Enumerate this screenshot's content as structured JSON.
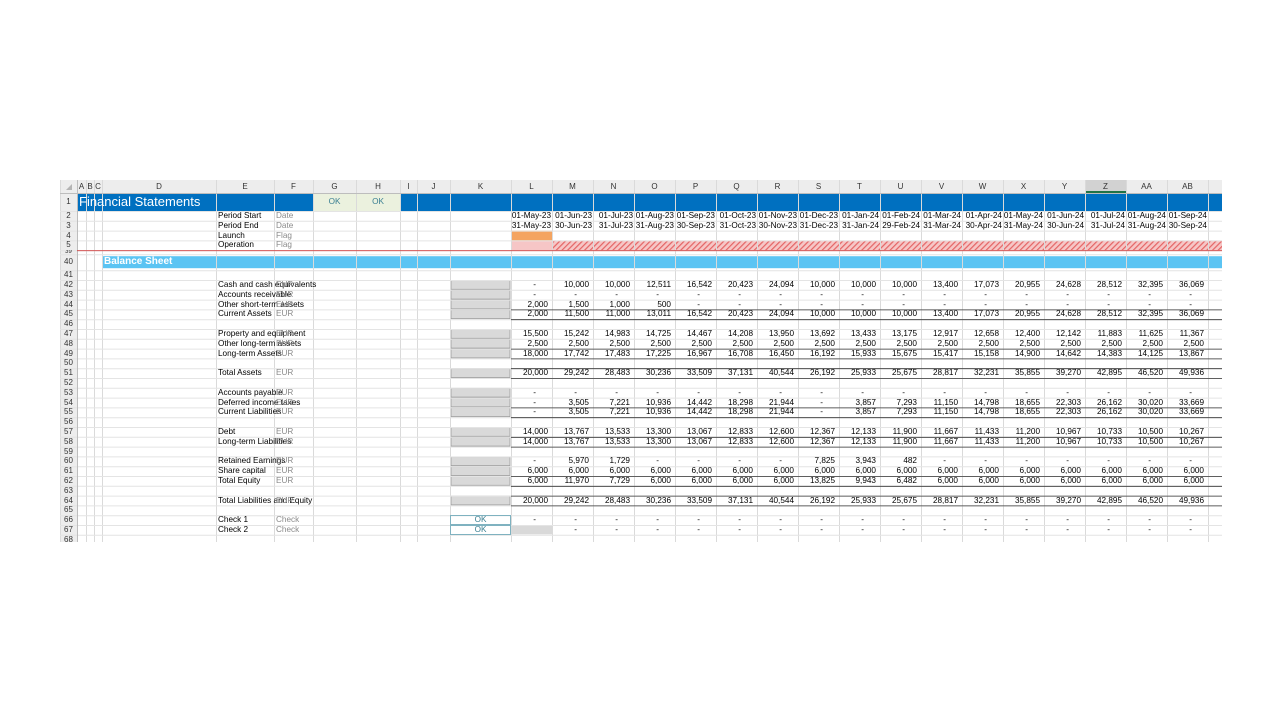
{
  "window": {
    "title": "Financial Statements"
  },
  "colors": {
    "title_band": "#0070C0",
    "section_band": "#5BC4F3",
    "ok_fill": "#EBF1DE",
    "launch_fill": "#F4A460",
    "operation_hatch": "#E46464",
    "input_grey": "#D9D9D9"
  },
  "columns": [
    "A",
    "B",
    "C",
    "D",
    "E",
    "F",
    "G",
    "H",
    "I",
    "J",
    "K",
    "L",
    "M",
    "N",
    "O",
    "P",
    "Q",
    "R",
    "S",
    "T",
    "U",
    "V",
    "W",
    "X",
    "Y",
    "Z",
    "AA",
    "AB"
  ],
  "selected_column": "Z",
  "header": {
    "title": "Financial Statements",
    "ok_cells": [
      "OK",
      "OK"
    ]
  },
  "timeline": [
    {
      "row": "2",
      "label": "Period Start",
      "unit": "Date",
      "values": [
        "01-May-23",
        "01-Jun-23",
        "01-Jul-23",
        "01-Aug-23",
        "01-Sep-23",
        "01-Oct-23",
        "01-Nov-23",
        "01-Dec-23",
        "01-Jan-24",
        "01-Feb-24",
        "01-Mar-24",
        "01-Apr-24",
        "01-May-24",
        "01-Jun-24",
        "01-Jul-24",
        "01-Aug-24",
        "01-Sep-24"
      ]
    },
    {
      "row": "3",
      "label": "Period End",
      "unit": "Date",
      "values": [
        "31-May-23",
        "30-Jun-23",
        "31-Jul-23",
        "31-Aug-23",
        "30-Sep-23",
        "31-Oct-23",
        "30-Nov-23",
        "31-Dec-23",
        "31-Jan-24",
        "29-Feb-24",
        "31-Mar-24",
        "30-Apr-24",
        "31-May-24",
        "30-Jun-24",
        "31-Jul-24",
        "31-Aug-24",
        "30-Sep-24"
      ]
    },
    {
      "row": "4",
      "label": "Launch",
      "unit": "Flag",
      "values": []
    },
    {
      "row": "5",
      "label": "Operation",
      "unit": "Flag",
      "values": []
    }
  ],
  "hidden_row_label": "39",
  "section": {
    "row": "40",
    "title": "Balance Sheet"
  },
  "rows": [
    {
      "row": "41",
      "label": "",
      "unit": "",
      "values": []
    },
    {
      "row": "42",
      "label": "Cash and cash equivalents",
      "unit": "EUR",
      "values": [
        "-",
        "10,000",
        "10,000",
        "12,511",
        "16,542",
        "20,423",
        "24,094",
        "10,000",
        "10,000",
        "10,000",
        "13,400",
        "17,073",
        "20,955",
        "24,628",
        "28,512",
        "32,395",
        "36,069"
      ]
    },
    {
      "row": "43",
      "label": "Accounts receivable",
      "unit": "EUR",
      "values": [
        "-",
        "-",
        "-",
        "-",
        "-",
        "-",
        "-",
        "-",
        "-",
        "-",
        "-",
        "-",
        "-",
        "-",
        "-",
        "-",
        "-"
      ]
    },
    {
      "row": "44",
      "label": "Other short-term assets",
      "unit": "EUR",
      "values": [
        "2,000",
        "1,500",
        "1,000",
        "500",
        "-",
        "-",
        "-",
        "-",
        "-",
        "-",
        "-",
        "-",
        "-",
        "-",
        "-",
        "-",
        "-"
      ]
    },
    {
      "row": "45",
      "label": "Current Assets",
      "unit": "EUR",
      "total": true,
      "values": [
        "2,000",
        "11,500",
        "11,000",
        "13,011",
        "16,542",
        "20,423",
        "24,094",
        "10,000",
        "10,000",
        "10,000",
        "13,400",
        "17,073",
        "20,955",
        "24,628",
        "28,512",
        "32,395",
        "36,069"
      ]
    },
    {
      "row": "46",
      "label": "",
      "unit": "",
      "values": []
    },
    {
      "row": "47",
      "label": "Property and equipment",
      "unit": "EUR",
      "values": [
        "15,500",
        "15,242",
        "14,983",
        "14,725",
        "14,467",
        "14,208",
        "13,950",
        "13,692",
        "13,433",
        "13,175",
        "12,917",
        "12,658",
        "12,400",
        "12,142",
        "11,883",
        "11,625",
        "11,367"
      ]
    },
    {
      "row": "48",
      "label": "Other long-term assets",
      "unit": "EUR",
      "values": [
        "2,500",
        "2,500",
        "2,500",
        "2,500",
        "2,500",
        "2,500",
        "2,500",
        "2,500",
        "2,500",
        "2,500",
        "2,500",
        "2,500",
        "2,500",
        "2,500",
        "2,500",
        "2,500",
        "2,500"
      ]
    },
    {
      "row": "49",
      "label": "Long-term Assets",
      "unit": "EUR",
      "total": true,
      "values": [
        "18,000",
        "17,742",
        "17,483",
        "17,225",
        "16,967",
        "16,708",
        "16,450",
        "16,192",
        "15,933",
        "15,675",
        "15,417",
        "15,158",
        "14,900",
        "14,642",
        "14,383",
        "14,125",
        "13,867"
      ]
    },
    {
      "row": "50",
      "label": "",
      "unit": "",
      "values": []
    },
    {
      "row": "51",
      "label": "Total Assets",
      "unit": "EUR",
      "total": true,
      "values": [
        "20,000",
        "29,242",
        "28,483",
        "30,236",
        "33,509",
        "37,131",
        "40,544",
        "26,192",
        "25,933",
        "25,675",
        "28,817",
        "32,231",
        "35,855",
        "39,270",
        "42,895",
        "46,520",
        "49,936"
      ]
    },
    {
      "row": "52",
      "label": "",
      "unit": "",
      "values": []
    },
    {
      "row": "53",
      "label": "Accounts payable",
      "unit": "EUR",
      "values": [
        "-",
        "-",
        "-",
        "-",
        "-",
        "-",
        "-",
        "-",
        "-",
        "-",
        "-",
        "-",
        "-",
        "-",
        "-",
        "-",
        "-"
      ]
    },
    {
      "row": "54",
      "label": "Deferred income taxes",
      "unit": "EUR",
      "values": [
        "-",
        "3,505",
        "7,221",
        "10,936",
        "14,442",
        "18,298",
        "21,944",
        "-",
        "3,857",
        "7,293",
        "11,150",
        "14,798",
        "18,655",
        "22,303",
        "26,162",
        "30,020",
        "33,669"
      ]
    },
    {
      "row": "55",
      "label": "Current Liabilities",
      "unit": "EUR",
      "total": true,
      "values": [
        "-",
        "3,505",
        "7,221",
        "10,936",
        "14,442",
        "18,298",
        "21,944",
        "-",
        "3,857",
        "7,293",
        "11,150",
        "14,798",
        "18,655",
        "22,303",
        "26,162",
        "30,020",
        "33,669"
      ]
    },
    {
      "row": "56",
      "label": "",
      "unit": "",
      "values": []
    },
    {
      "row": "57",
      "label": "Debt",
      "unit": "EUR",
      "values": [
        "14,000",
        "13,767",
        "13,533",
        "13,300",
        "13,067",
        "12,833",
        "12,600",
        "12,367",
        "12,133",
        "11,900",
        "11,667",
        "11,433",
        "11,200",
        "10,967",
        "10,733",
        "10,500",
        "10,267"
      ]
    },
    {
      "row": "58",
      "label": "Long-term Liabilities",
      "unit": "EUR",
      "total": true,
      "values": [
        "14,000",
        "13,767",
        "13,533",
        "13,300",
        "13,067",
        "12,833",
        "12,600",
        "12,367",
        "12,133",
        "11,900",
        "11,667",
        "11,433",
        "11,200",
        "10,967",
        "10,733",
        "10,500",
        "10,267"
      ]
    },
    {
      "row": "59",
      "label": "",
      "unit": "",
      "values": []
    },
    {
      "row": "60",
      "label": "Retained Earnings",
      "unit": "EUR",
      "values": [
        "-",
        "5,970",
        "1,729",
        "-",
        "-",
        "-",
        "-",
        "7,825",
        "3,943",
        "482",
        "-",
        "-",
        "-",
        "-",
        "-",
        "-",
        "-"
      ]
    },
    {
      "row": "61",
      "label": "Share capital",
      "unit": "EUR",
      "values": [
        "6,000",
        "6,000",
        "6,000",
        "6,000",
        "6,000",
        "6,000",
        "6,000",
        "6,000",
        "6,000",
        "6,000",
        "6,000",
        "6,000",
        "6,000",
        "6,000",
        "6,000",
        "6,000",
        "6,000"
      ]
    },
    {
      "row": "62",
      "label": "Total Equity",
      "unit": "EUR",
      "total": true,
      "values": [
        "6,000",
        "11,970",
        "7,729",
        "6,000",
        "6,000",
        "6,000",
        "6,000",
        "13,825",
        "9,943",
        "6,482",
        "6,000",
        "6,000",
        "6,000",
        "6,000",
        "6,000",
        "6,000",
        "6,000"
      ]
    },
    {
      "row": "63",
      "label": "",
      "unit": "",
      "values": []
    },
    {
      "row": "64",
      "label": "Total Liabilities and Equity",
      "unit": "EUR",
      "total": true,
      "values": [
        "20,000",
        "29,242",
        "28,483",
        "30,236",
        "33,509",
        "37,131",
        "40,544",
        "26,192",
        "25,933",
        "25,675",
        "28,817",
        "32,231",
        "35,855",
        "39,270",
        "42,895",
        "46,520",
        "49,936"
      ]
    },
    {
      "row": "65",
      "label": "",
      "unit": "",
      "values": []
    },
    {
      "row": "66",
      "label": "Check 1",
      "unit": "Check",
      "check": "OK",
      "values": [
        "-",
        "-",
        "-",
        "-",
        "-",
        "-",
        "-",
        "-",
        "-",
        "-",
        "-",
        "-",
        "-",
        "-",
        "-",
        "-",
        "-"
      ]
    },
    {
      "row": "67",
      "label": "Check 2",
      "unit": "Check",
      "check": "OK",
      "values": [
        "",
        "-",
        "-",
        "-",
        "-",
        "-",
        "-",
        "-",
        "-",
        "-",
        "-",
        "-",
        "-",
        "-",
        "-",
        "-",
        "-"
      ]
    },
    {
      "row": "68",
      "label": "",
      "unit": "",
      "values": []
    }
  ]
}
